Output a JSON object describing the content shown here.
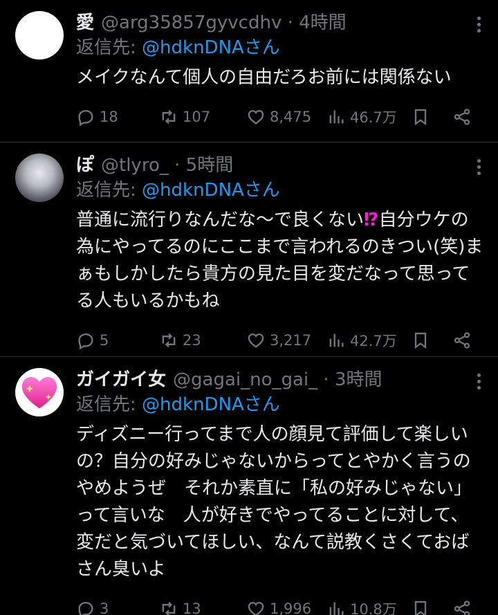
{
  "replies": [
    {
      "name": "愛",
      "handle": "@arg35857gyvcdhv",
      "time": "4時間",
      "replying_label": "返信先: ",
      "replying_to": "@hdknDNAさん",
      "text": "メイクなんて個人の自由だろお前には関係ない",
      "text_suffix": "",
      "text_cont": "",
      "replies": "18",
      "reposts": "107",
      "likes": "8,475",
      "views": "46.7万"
    },
    {
      "name": "ぽ",
      "handle": "@tlyro_",
      "time": "5時間",
      "replying_label": "返信先: ",
      "replying_to": "@hdknDNAさん",
      "text": "普通に流行りなんだな〜で良くない",
      "text_suffix": "⁉",
      "text_cont": "自分ウケの為にやってるのにここまで言われるのきつい(笑)まぁもしかしたら貴方の見た目を変だなって思ってる人もいるかもね",
      "replies": "5",
      "reposts": "23",
      "likes": "3,217",
      "views": "42.7万"
    },
    {
      "name": "ガイガイ女",
      "handle": "@gagai_no_gai_",
      "time": "3時間",
      "replying_label": "返信先: ",
      "replying_to": "@hdknDNAさん",
      "text": "ディズニー行ってまで人の顔見て評価して楽しいの？自分の好みじゃないからってとやかく言うのやめようぜ　それか素直に「私の好みじゃない」って言いな　人が好きでやってることに対して、変だと気づいてほしい、なんて説教くさくておばさん臭いよ",
      "text_suffix": "",
      "text_cont": "",
      "replies": "3",
      "reposts": "13",
      "likes": "1,996",
      "views": "10.8万"
    }
  ],
  "icons": {
    "reply": "reply-icon",
    "repost": "repost-icon",
    "like": "heart-icon",
    "views": "views-icon",
    "bookmark": "bookmark-icon",
    "share": "share-icon",
    "more": "more-icon"
  },
  "colors": {
    "background": "#000000",
    "text": "#e7e9ea",
    "muted": "#71767b",
    "link": "#1d9bf0",
    "interrobang": "#f91bd9"
  }
}
